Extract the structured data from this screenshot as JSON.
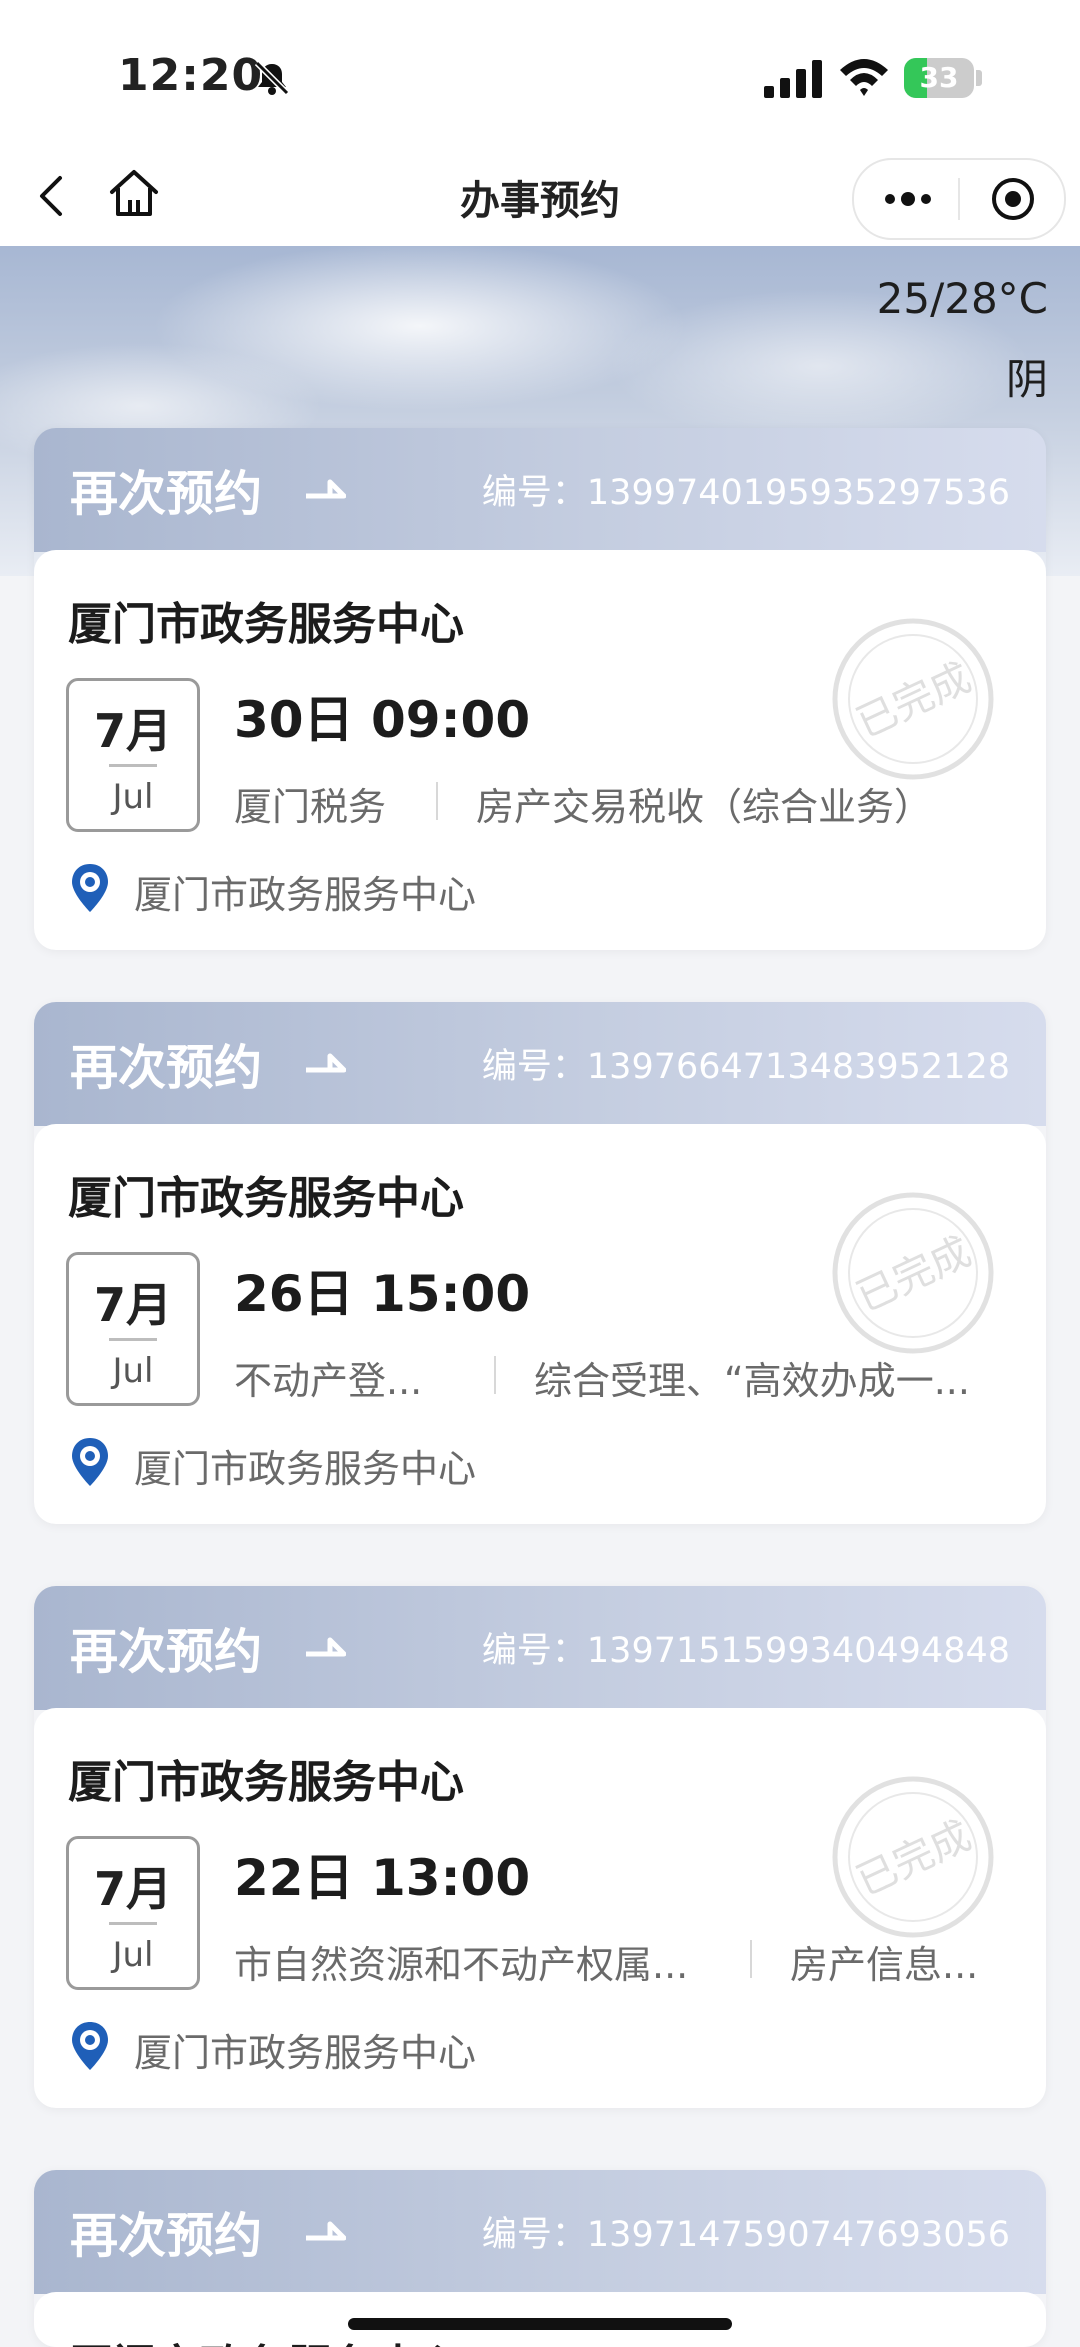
{
  "status_bar": {
    "time": "12:20",
    "battery": "33",
    "battery_level": 0.33
  },
  "nav": {
    "title": "办事预约"
  },
  "weather": {
    "temperature": "25/28°C",
    "condition": "阴"
  },
  "colors": {
    "accent_blue": "#1f5fb8",
    "card_header": "#b9c4da"
  },
  "cards": [
    {
      "rebook_label": "再次预约",
      "serial": "编号：1399740195935297536",
      "center": "厦门市政务服务中心",
      "month_cn": "7月",
      "month_en": "Jul",
      "day_time": "30日 09:00",
      "department": "厦门税务",
      "service": "房产交易税收（综合业务）",
      "location": "厦门市政务服务中心",
      "stamp_text": "已完成"
    },
    {
      "rebook_label": "再次预约",
      "serial": "编号：1397664713483952128",
      "center": "厦门市政务服务中心",
      "month_cn": "7月",
      "month_en": "Jul",
      "day_time": "26日 15:00",
      "department": "不动产登...",
      "service": "综合受理、“高效办成一...",
      "location": "厦门市政务服务中心",
      "stamp_text": "已完成"
    },
    {
      "rebook_label": "再次预约",
      "serial": "编号：1397151599340494848",
      "center": "厦门市政务服务中心",
      "month_cn": "7月",
      "month_en": "Jul",
      "day_time": "22日 13:00",
      "department": "市自然资源和不动产权属...",
      "service": "房产信息...",
      "location": "厦门市政务服务中心",
      "stamp_text": "已完成"
    },
    {
      "rebook_label": "再次预约",
      "serial": "编号：1397147590747693056",
      "center": "厦门市政务服务中心"
    }
  ]
}
